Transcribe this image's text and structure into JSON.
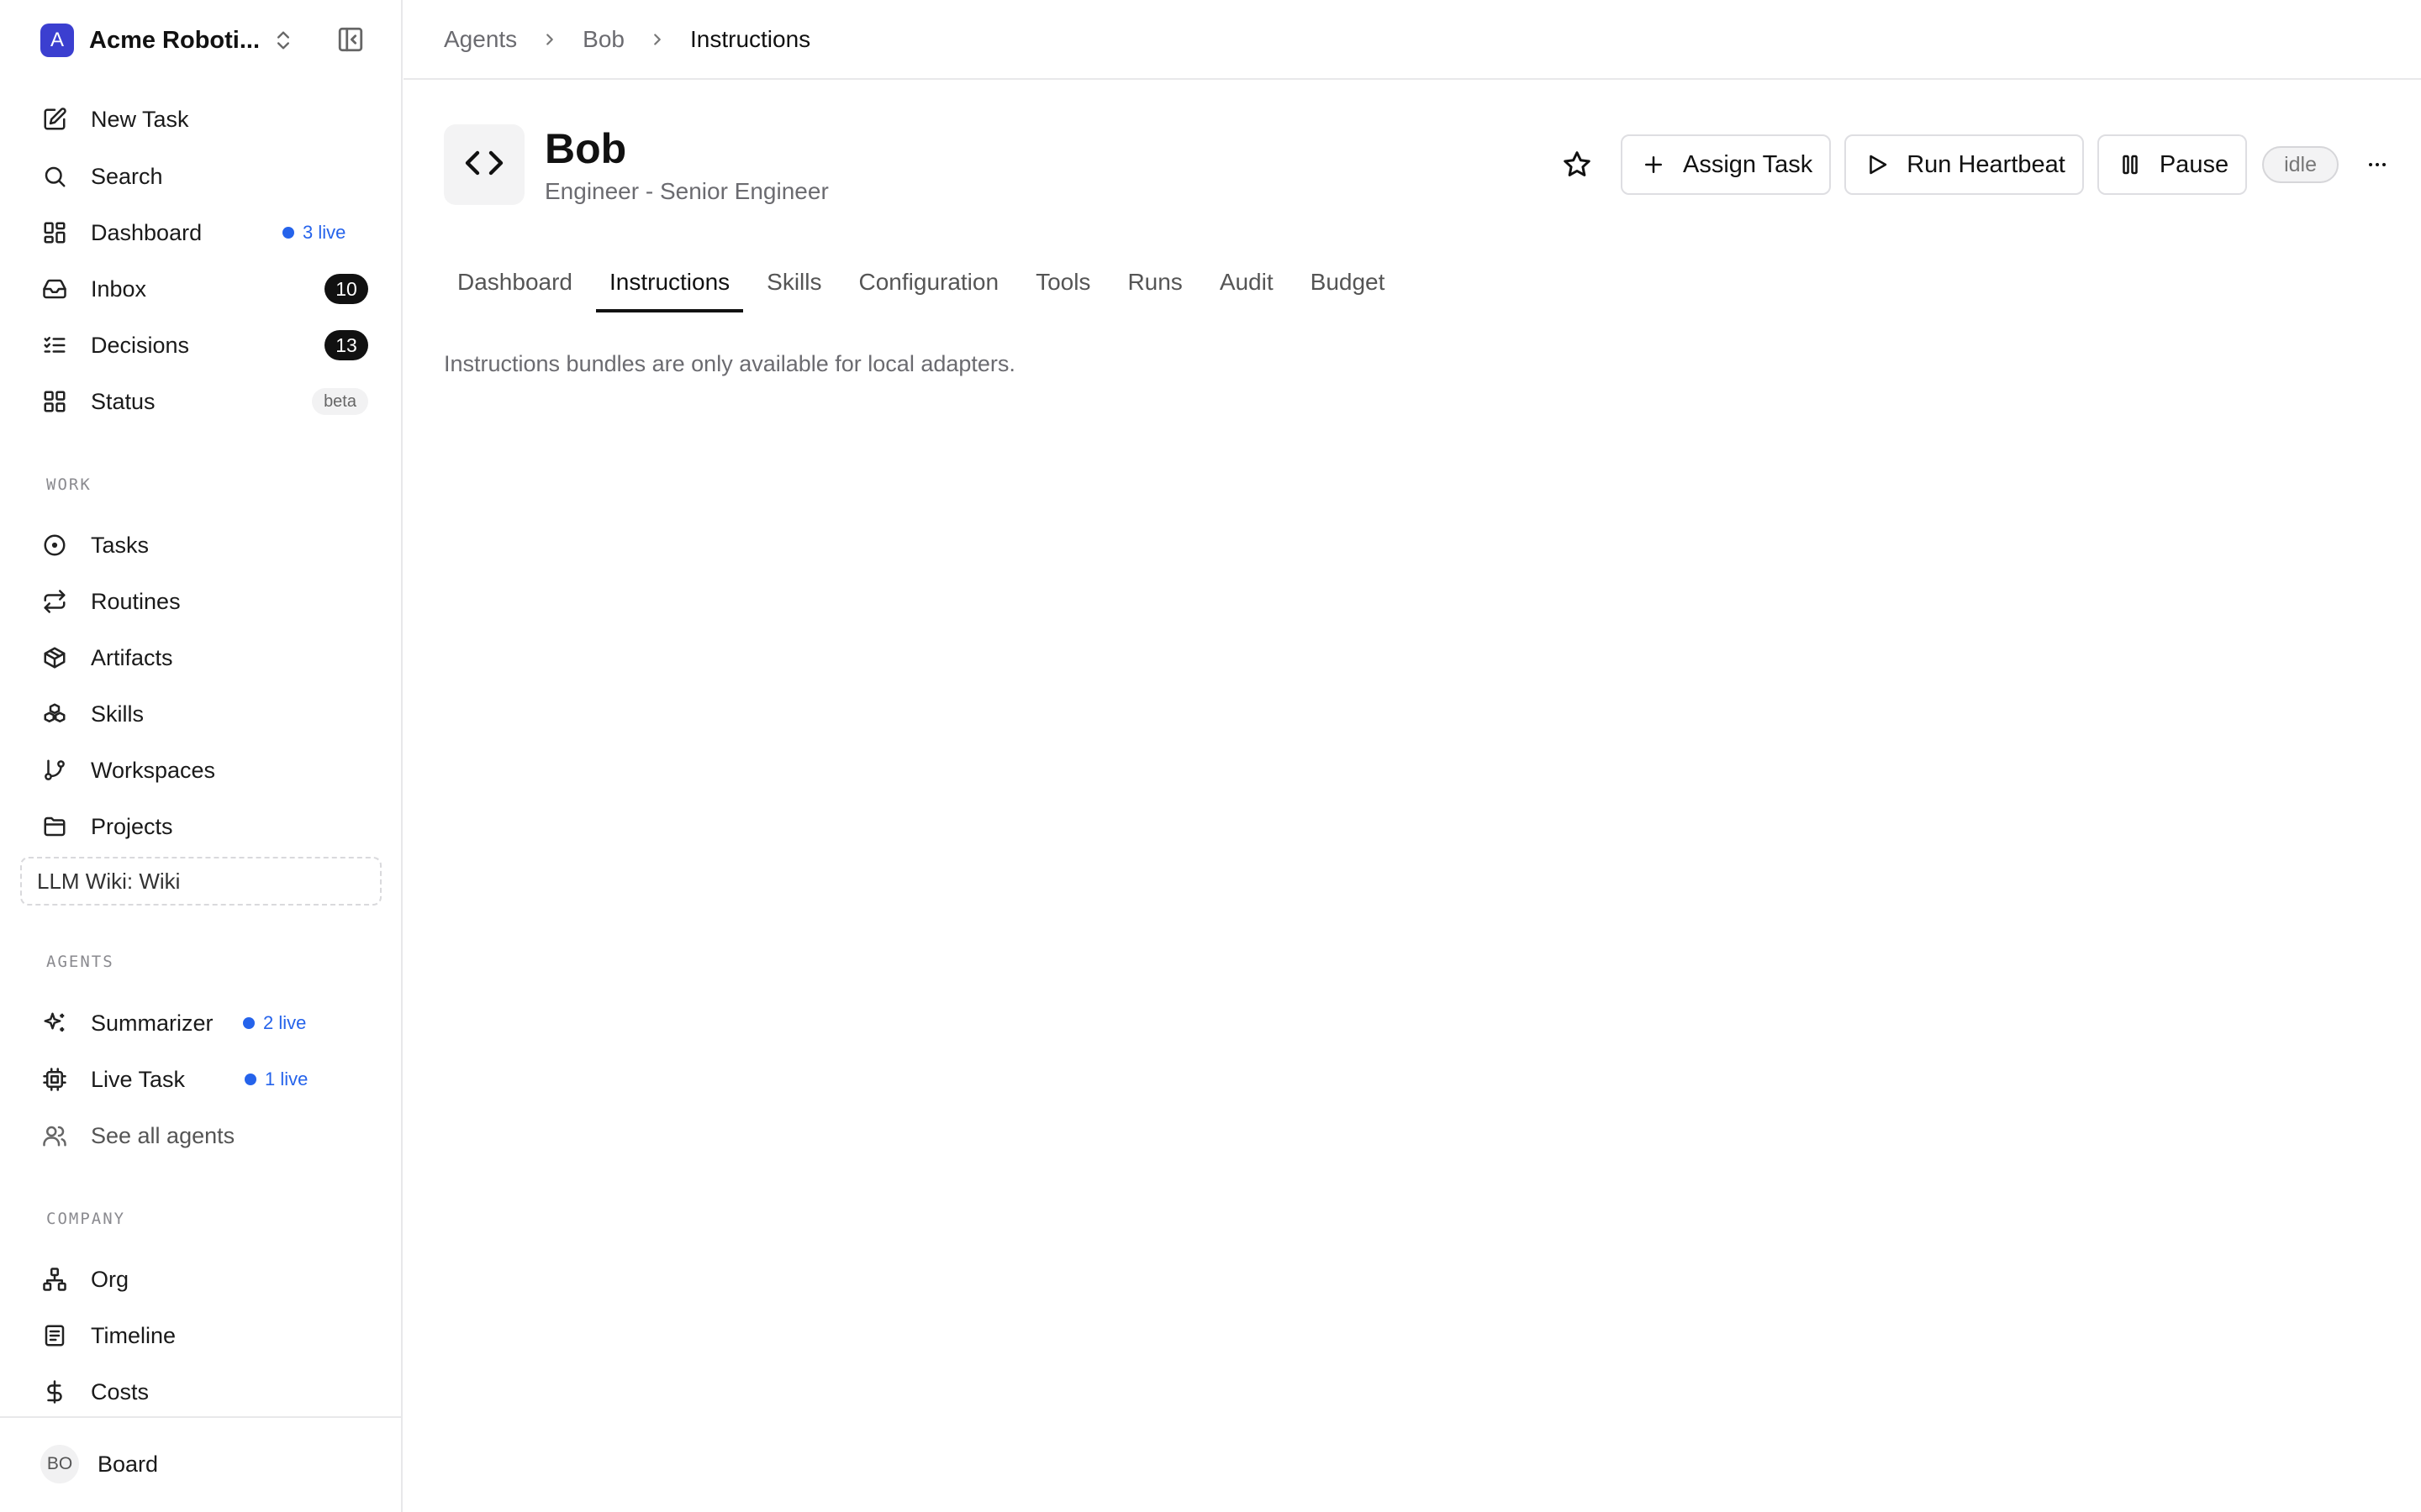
{
  "org": {
    "logo_letter": "A",
    "name": "Acme Roboti..."
  },
  "nav": {
    "primary": [
      {
        "label": "New Task",
        "icon": "edit-icon"
      },
      {
        "label": "Search",
        "icon": "search-icon"
      },
      {
        "label": "Dashboard",
        "icon": "dashboard-icon",
        "live": "3 live"
      },
      {
        "label": "Inbox",
        "icon": "inbox-icon",
        "count": "10"
      },
      {
        "label": "Decisions",
        "icon": "list-checks-icon",
        "count": "13"
      },
      {
        "label": "Status",
        "icon": "grid-icon",
        "badge": "beta"
      }
    ],
    "work_label": "WORK",
    "work": [
      {
        "label": "Tasks",
        "icon": "circle-dot-icon"
      },
      {
        "label": "Routines",
        "icon": "repeat-icon"
      },
      {
        "label": "Artifacts",
        "icon": "package-icon"
      },
      {
        "label": "Skills",
        "icon": "boxes-icon"
      },
      {
        "label": "Workspaces",
        "icon": "git-branch-icon"
      },
      {
        "label": "Projects",
        "icon": "folder-icon"
      }
    ],
    "wiki": "LLM Wiki: Wiki",
    "agents_label": "AGENTS",
    "agents": [
      {
        "label": "Summarizer",
        "icon": "sparkles-icon",
        "live": "2 live"
      },
      {
        "label": "Live Task",
        "icon": "cpu-icon",
        "live": "1 live"
      },
      {
        "label": "See all agents",
        "icon": "users-icon"
      }
    ],
    "company_label": "COMPANY",
    "company": [
      {
        "label": "Org",
        "icon": "org-chart-icon"
      },
      {
        "label": "Timeline",
        "icon": "timeline-icon"
      },
      {
        "label": "Costs",
        "icon": "dollar-icon"
      }
    ]
  },
  "user": {
    "initials": "BO",
    "name": "Board"
  },
  "breadcrumb": [
    "Agents",
    "Bob",
    "Instructions"
  ],
  "agent": {
    "name": "Bob",
    "role": "Engineer - Senior Engineer",
    "status": "idle"
  },
  "actions": {
    "assign": "Assign Task",
    "heartbeat": "Run Heartbeat",
    "pause": "Pause",
    "more": "···"
  },
  "tabs": [
    "Dashboard",
    "Instructions",
    "Skills",
    "Configuration",
    "Tools",
    "Runs",
    "Audit",
    "Budget"
  ],
  "active_tab": "Instructions",
  "content": {
    "message": "Instructions bundles are only available for local adapters."
  },
  "colors": {
    "accent": "#2563eb",
    "logo": "#3b3fd0",
    "badge_dark": "#111111"
  }
}
